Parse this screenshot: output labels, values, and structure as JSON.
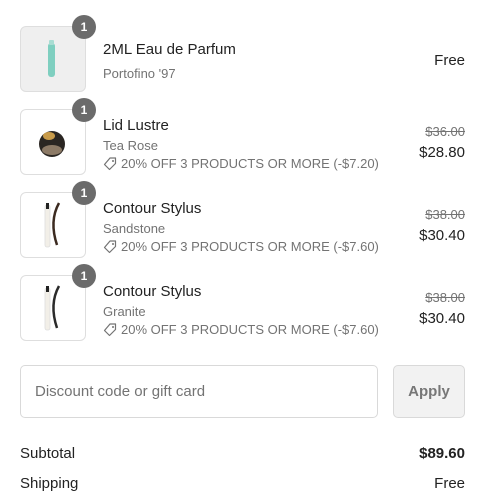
{
  "items": [
    {
      "quantity": "1",
      "name": "2ML Eau de Parfum",
      "variant": "Portofino '97",
      "promo": "",
      "original_price": "",
      "price": "Free"
    },
    {
      "quantity": "1",
      "name": "Lid Lustre",
      "variant": "Tea Rose",
      "promo": "20% OFF 3 PRODUCTS OR MORE (-$7.20)",
      "original_price": "$36.00",
      "price": "$28.80"
    },
    {
      "quantity": "1",
      "name": "Contour Stylus",
      "variant": "Sandstone",
      "promo": "20% OFF 3 PRODUCTS OR MORE (-$7.60)",
      "original_price": "$38.00",
      "price": "$30.40"
    },
    {
      "quantity": "1",
      "name": "Contour Stylus",
      "variant": "Granite",
      "promo": "20% OFF 3 PRODUCTS OR MORE (-$7.60)",
      "original_price": "$38.00",
      "price": "$30.40"
    }
  ],
  "discount": {
    "placeholder": "Discount code or gift card",
    "value": "",
    "apply_label": "Apply"
  },
  "summary": {
    "subtotal_label": "Subtotal",
    "subtotal_value": "$89.60",
    "shipping_label": "Shipping",
    "shipping_value": "Free"
  },
  "colors": {
    "badge": "#6b6b6b",
    "muted_text": "#737373",
    "border": "#dedede"
  }
}
